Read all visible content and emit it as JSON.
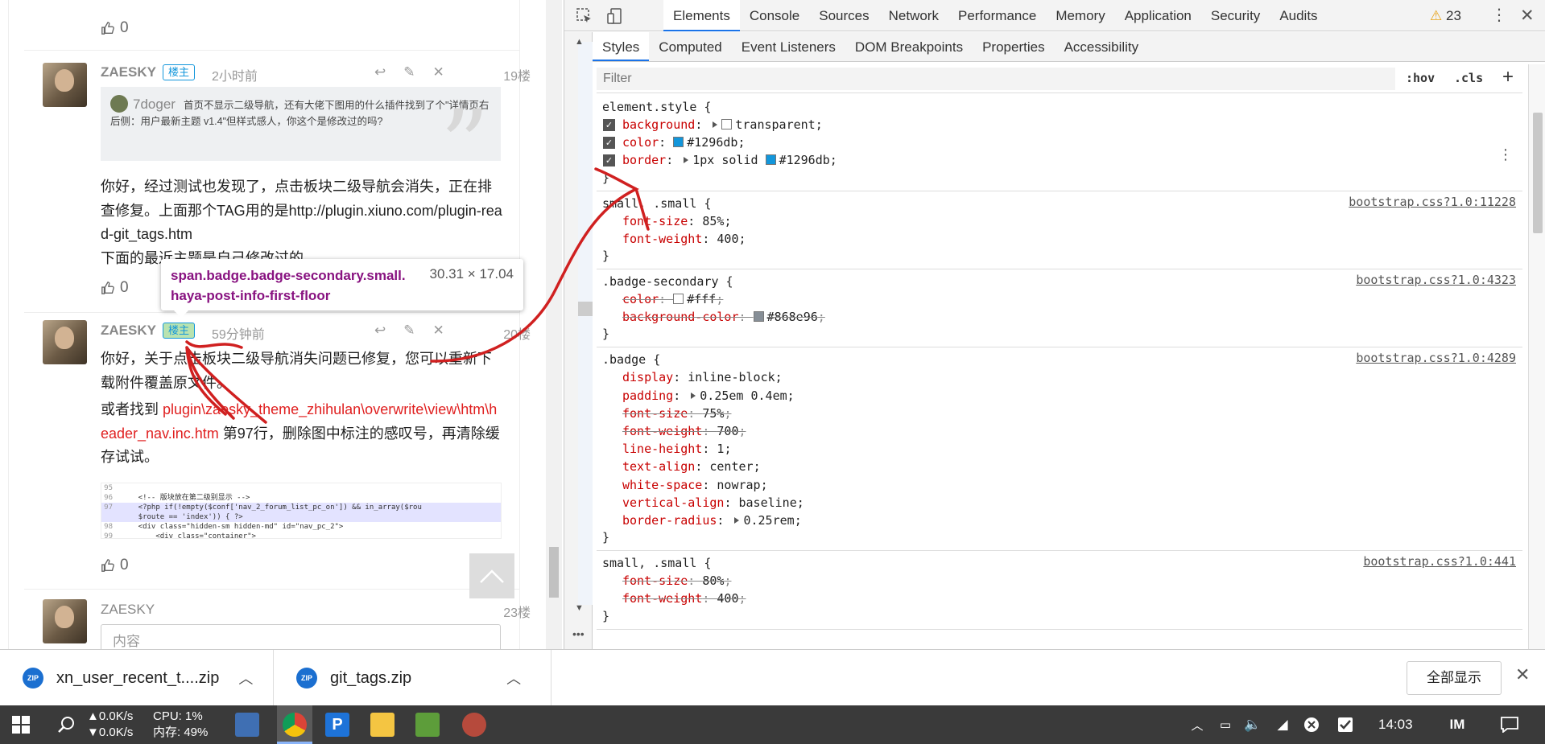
{
  "forum": {
    "like_count_1": "0",
    "post19": {
      "author": "ZAESKY",
      "badge": "楼主",
      "time": "2小时前",
      "floor": "19楼",
      "quote_author": "7doger",
      "quote_text": "首页不显示二级导航，还有大佬下图用的什么插件找到了个\"详情页右后侧：用户最新主题 v1.4\"但样式感人，你这个是修改过的吗?",
      "text": "你好，经过测试也发现了，点击板块二级导航会消失，正在排查修复。上面那个TAG用的是http://plugin.xiuno.com/plugin-read-git_tags.htm",
      "text2": "下面的最近主题是自己修改过的",
      "likes": "0"
    },
    "tooltip": {
      "selector": "span.badge.badge-secondary.small.haya-post-info-first-floor",
      "size": "30.31 × 17.04"
    },
    "post20": {
      "author": "ZAESKY",
      "badge": "楼主",
      "time": "59分钟前",
      "floor": "20楼",
      "text1": "你好，关于点击板块二级导航消失问题已修复，您可以重新下载附件覆盖原文件。",
      "text2_prefix": "或者找到 ",
      "text2_path": "plugin\\zaesky_theme_zhihulan\\overwrite\\view\\htm\\header_nav.inc.htm",
      "text2_suffix": " 第97行，删除图中标注的感叹号，再清除缓存试试。",
      "code": [
        {
          "ln": "95",
          "code": ""
        },
        {
          "ln": "96",
          "code": "    <!-- 版块放在第二级别显示 -->"
        },
        {
          "ln": "97",
          "code": "    <?php if(!empty($conf['nav_2_forum_list_pc_on']) && in_array($rou"
        },
        {
          "ln": "",
          "code": "    $route == 'index')) { ?>"
        },
        {
          "ln": "98",
          "code": "    <div class=\"hidden-sm hidden-md\" id=\"nav_pc_2\">"
        },
        {
          "ln": "99",
          "code": "        <div class=\"container\">"
        }
      ],
      "likes": "0"
    },
    "post23": {
      "author": "ZAESKY",
      "floor": "23楼",
      "placeholder": "内容"
    }
  },
  "devtools": {
    "tabs": [
      "Elements",
      "Console",
      "Sources",
      "Network",
      "Performance",
      "Memory",
      "Application",
      "Security",
      "Audits"
    ],
    "warnings": "23",
    "subtabs": [
      "Styles",
      "Computed",
      "Event Listeners",
      "DOM Breakpoints",
      "Properties",
      "Accessibility"
    ],
    "filter_placeholder": "Filter",
    "hov": ":hov",
    "cls": ".cls",
    "rules": [
      {
        "selector": "element.style {",
        "source": "",
        "decls": [
          {
            "name": "background",
            "value": "transparent",
            "swatch": "#ffffff",
            "checkbox": true,
            "tri": true
          },
          {
            "name": "color",
            "value": "#1296db",
            "swatch": "#1296db",
            "checkbox": true
          },
          {
            "name": "border",
            "value": "1px solid",
            "value2": "#1296db",
            "swatch": "#1296db",
            "checkbox": true,
            "tri": true
          }
        ]
      },
      {
        "selector": "small, .small {",
        "source": "bootstrap.css?1.0:11228",
        "decls": [
          {
            "name": "font-size",
            "value": "85%"
          },
          {
            "name": "font-weight",
            "value": "400"
          }
        ]
      },
      {
        "selector": ".badge-secondary {",
        "source": "bootstrap.css?1.0:4323",
        "decls": [
          {
            "name": "color",
            "value": "#fff",
            "swatch": "#ffffff",
            "strike": true
          },
          {
            "name": "background-color",
            "value": "#868e96",
            "swatch": "#868e96",
            "strike": true
          }
        ]
      },
      {
        "selector": ".badge {",
        "source": "bootstrap.css?1.0:4289",
        "decls": [
          {
            "name": "display",
            "value": "inline-block"
          },
          {
            "name": "padding",
            "value": "0.25em 0.4em",
            "tri": true
          },
          {
            "name": "font-size",
            "value": "75%",
            "strike": true
          },
          {
            "name": "font-weight",
            "value": "700",
            "strike": true
          },
          {
            "name": "line-height",
            "value": "1"
          },
          {
            "name": "text-align",
            "value": "center"
          },
          {
            "name": "white-space",
            "value": "nowrap"
          },
          {
            "name": "vertical-align",
            "value": "baseline"
          },
          {
            "name": "border-radius",
            "value": "0.25rem",
            "tri": true
          }
        ]
      },
      {
        "selector": "small, .small {",
        "source": "bootstrap.css?1.0:441",
        "decls": [
          {
            "name": "font-size",
            "value": "80%",
            "strike": true
          },
          {
            "name": "font-weight",
            "value": "400",
            "strike": true
          }
        ]
      }
    ]
  },
  "downloads": {
    "items": [
      {
        "name": "xn_user_recent_t....zip"
      },
      {
        "name": "git_tags.zip"
      }
    ],
    "show_all": "全部显示"
  },
  "taskbar": {
    "up_speed": "▲0.0K/s",
    "down_speed": "▼0.0K/s",
    "cpu": "CPU: 1%",
    "mem": "内存: 49%",
    "clock": "14:03"
  },
  "colors": {
    "accent": "#1296db",
    "annotation": "#d02020"
  }
}
